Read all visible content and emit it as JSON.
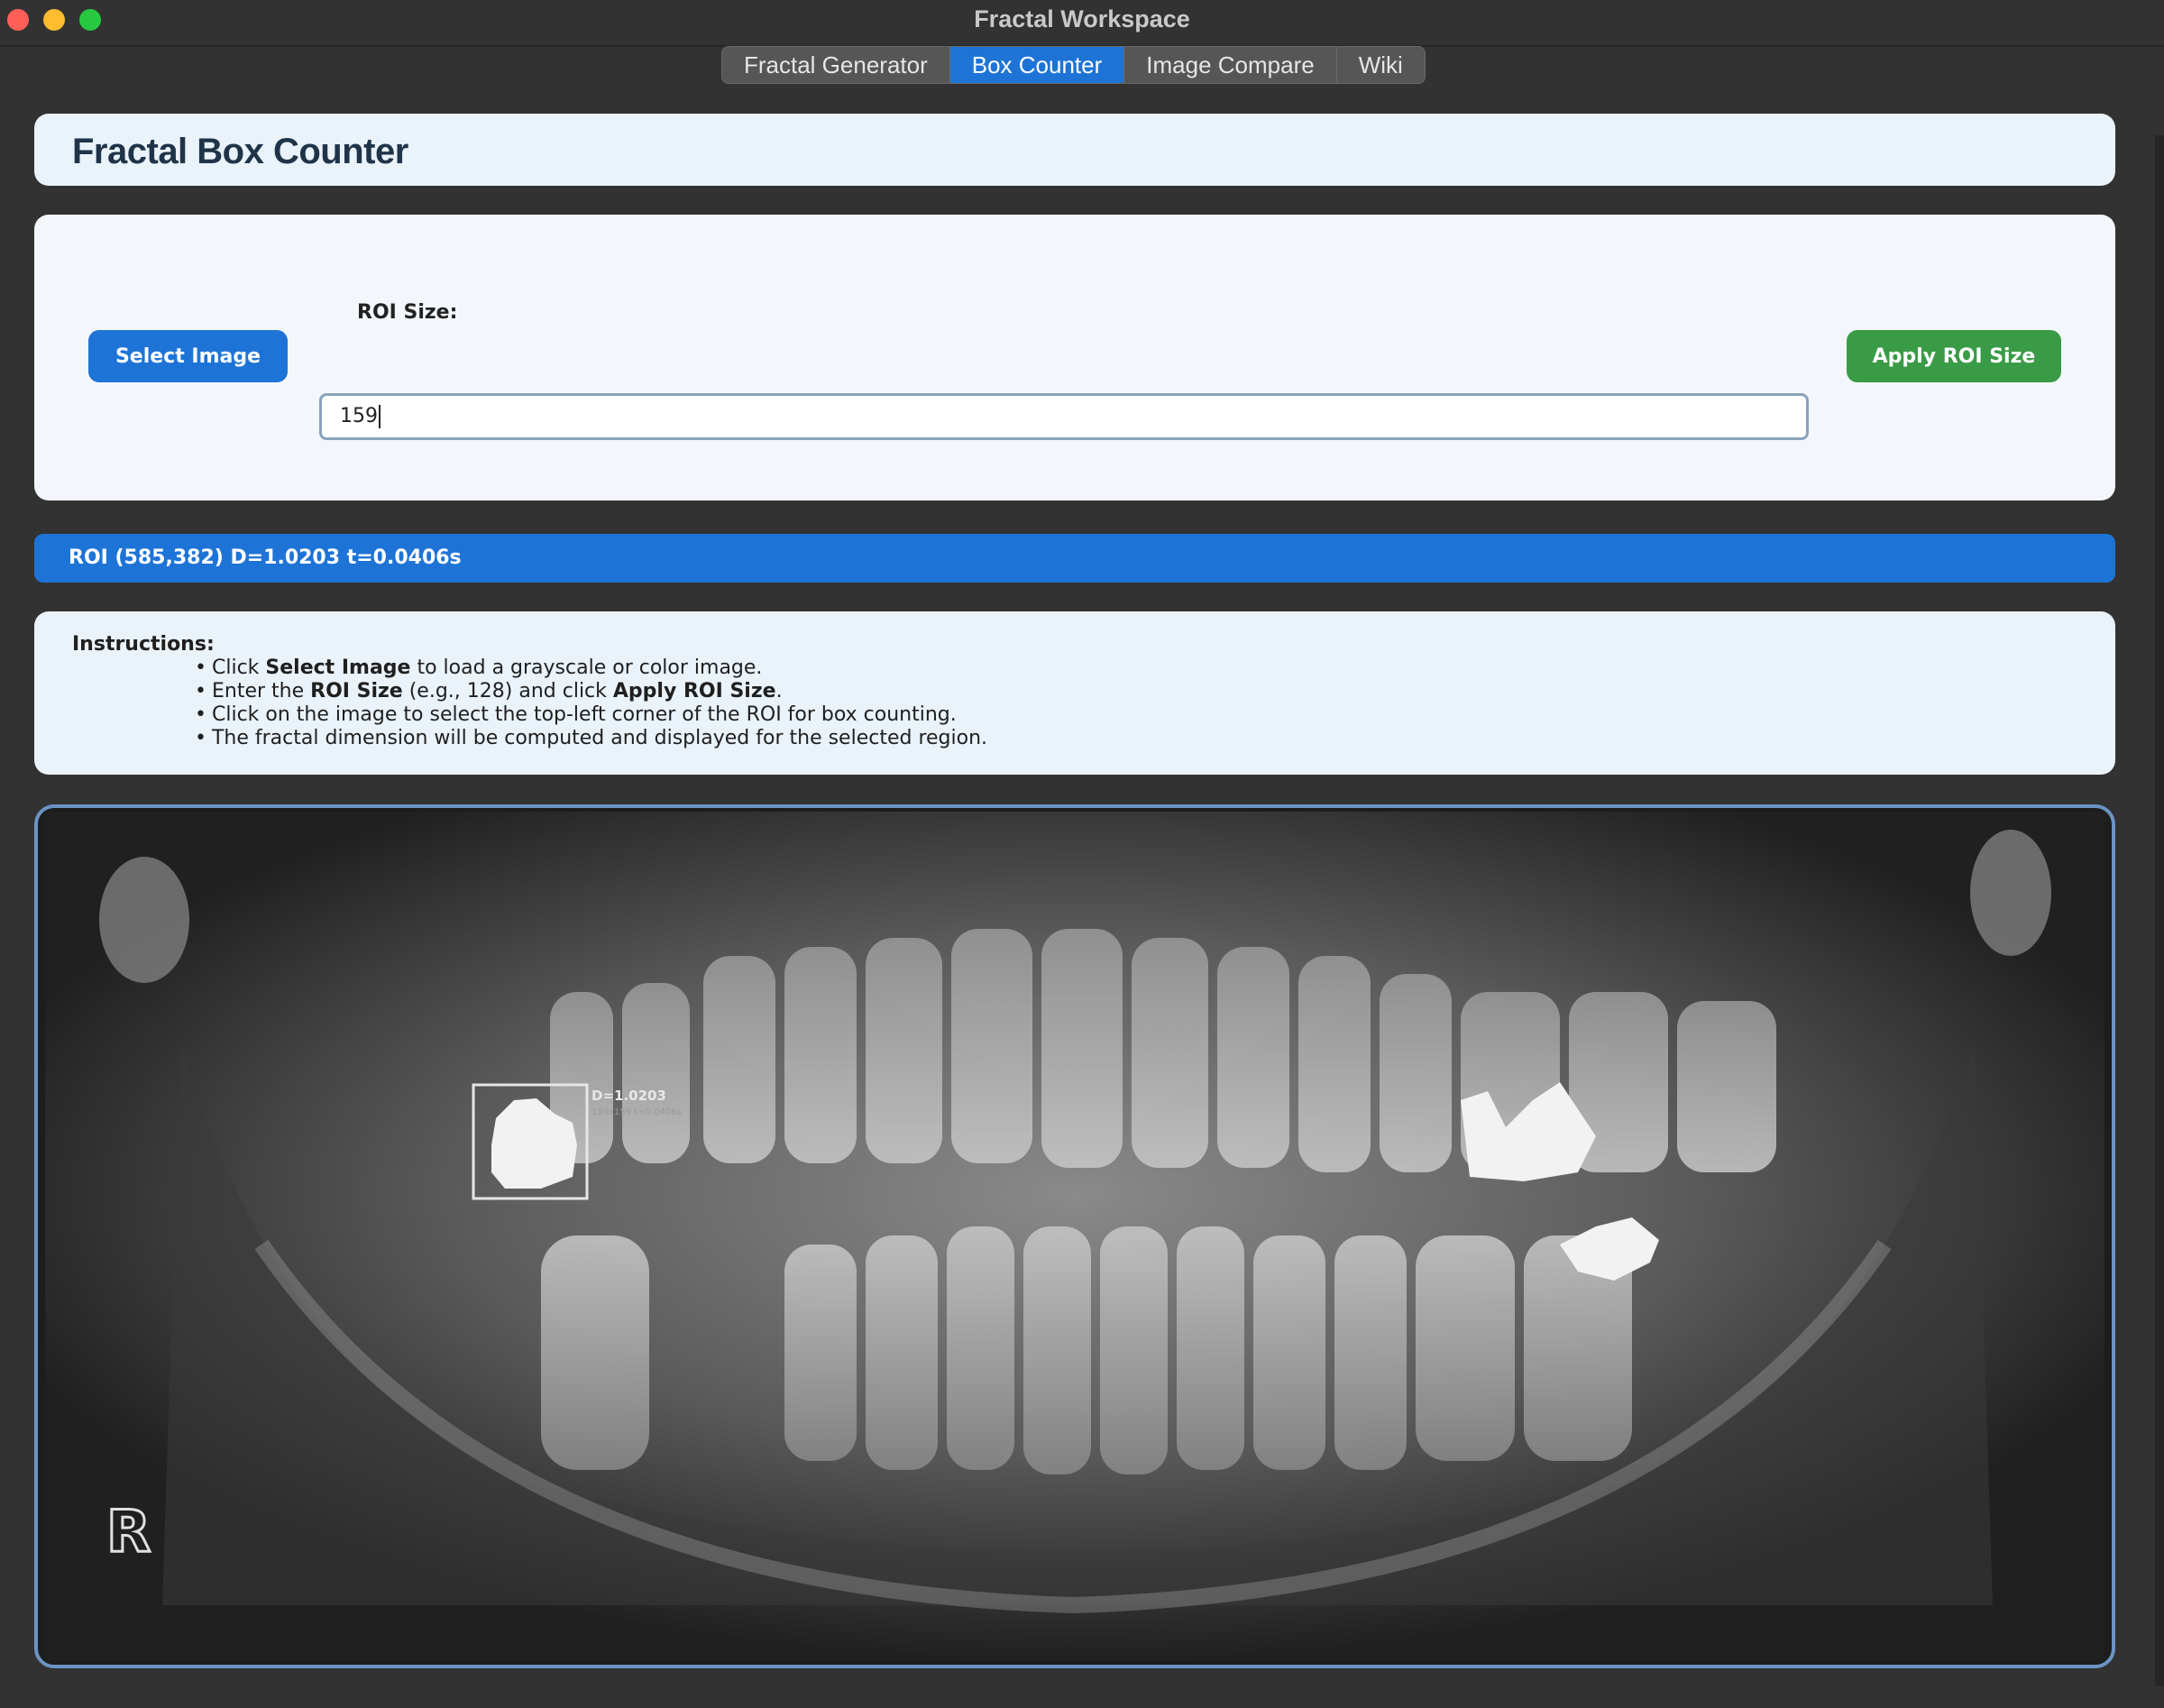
{
  "window": {
    "title": "Fractal Workspace"
  },
  "tabs": [
    {
      "label": "Fractal Generator",
      "active": false
    },
    {
      "label": "Box Counter",
      "active": true
    },
    {
      "label": "Image Compare",
      "active": false
    },
    {
      "label": "Wiki",
      "active": false
    }
  ],
  "header": {
    "title": "Fractal Box Counter"
  },
  "controls": {
    "select_image_label": "Select Image",
    "roi_size_label": "ROI Size:",
    "roi_size_value": "159",
    "apply_label": "Apply ROI Size"
  },
  "status": {
    "text": "ROI (585,382) D=1.0203 t=0.0406s"
  },
  "instructions": {
    "title": "Instructions:",
    "items": [
      [
        "Click ",
        "Select Image",
        " to load a grayscale or color image."
      ],
      [
        "Enter the ",
        "ROI Size",
        " (e.g., 128) and click ",
        "Apply ROI Size",
        "."
      ],
      [
        "Click on the image to select the top-left corner of the ROI for box counting."
      ],
      [
        "The fractal dimension will be computed and displayed for the selected region."
      ]
    ]
  },
  "image_overlay": {
    "roi_label": "D=1.0203",
    "roi_sublabel": "159x159 t=0.0406s",
    "marker_letter": "R"
  },
  "colors": {
    "accent_blue": "#1e74d6",
    "apply_green": "#3a9b46",
    "panel_bg": "#eaf2fa",
    "window_bg": "#323232"
  }
}
